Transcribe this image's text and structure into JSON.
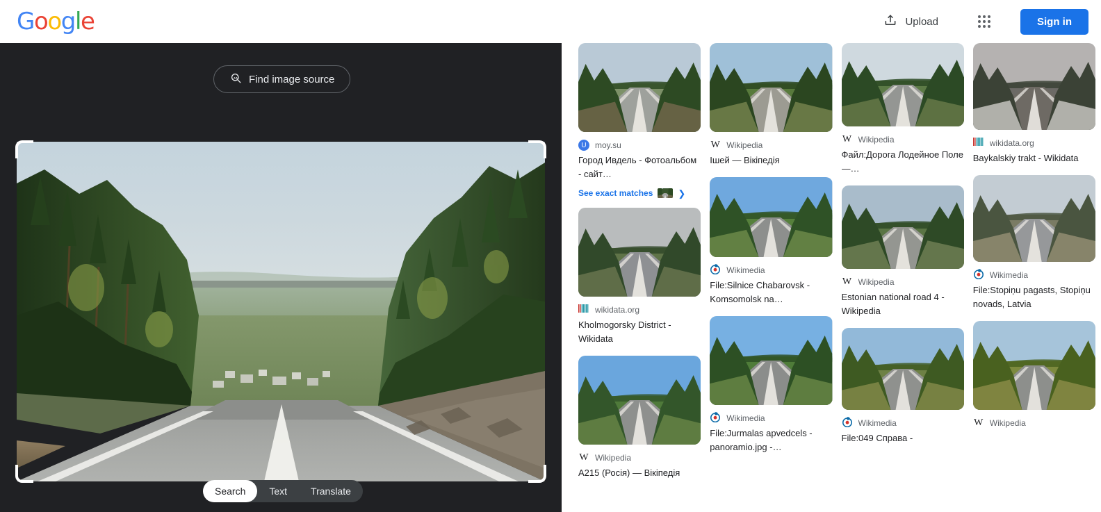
{
  "header": {
    "logo_text": "Google",
    "upload_label": "Upload",
    "upload_icon": "upload-icon",
    "apps_icon": "apps-grid-icon",
    "signin_label": "Sign in"
  },
  "left_pane": {
    "find_source_label": "Find image source",
    "find_source_icon": "image-search-icon",
    "modes": [
      {
        "label": "Search",
        "active": true
      },
      {
        "label": "Text",
        "active": false
      },
      {
        "label": "Translate",
        "active": false
      }
    ],
    "crop_handles": [
      "top-left",
      "top-right",
      "bottom-left",
      "bottom-right"
    ],
    "image_alt": "Forested highway descending toward a valley town"
  },
  "colors": {
    "accent_blue": "#1a73e8",
    "dark_panel": "#202124",
    "tab_track": "#3c4043",
    "text_primary": "#202124",
    "text_secondary": "#5f6368"
  },
  "results": [
    {
      "source": "moy.su",
      "favicon": "letter-u-favicon",
      "title": "Город Ивдель - Фотоальбом - сайт…",
      "thumb": "road-descending-valley",
      "thumb_height": 128,
      "column": 0,
      "exact_matches_label": "See exact matches"
    },
    {
      "source": "wikidata.org",
      "favicon": "wikidata-barcode-favicon",
      "title": "Kholmogorsky District - Wikidata",
      "thumb": "wet-road-grey-sky",
      "thumb_height": 128,
      "column": 1
    },
    {
      "source": "Wikipedia",
      "favicon": "wikipedia-w-favicon",
      "title": "А215 (Росія) — Вікіпедія",
      "thumb": "blue-sky-forest-road",
      "thumb_height": 128,
      "column": 2
    },
    {
      "source": "Wikipedia",
      "favicon": "wikipedia-w-favicon",
      "title": "Ішей — Вікіпедія",
      "thumb": "green-forest-roadside",
      "thumb_height": 128,
      "column": 3
    },
    {
      "source": "Wikimedia",
      "favicon": "wikimedia-globe-favicon",
      "title": "File:Silnice Chabarovsk - Komsomolsk na…",
      "thumb": "wide-highway-blue-sky",
      "thumb_height": 115,
      "column": 0
    },
    {
      "source": "Wikimedia",
      "favicon": "wikimedia-globe-favicon",
      "title": "File:Jurmalas apvedcels - panoramio.jpg -…",
      "thumb": "road-with-white-truck",
      "thumb_height": 128,
      "column": 1
    },
    {
      "source": "Wikipedia",
      "favicon": "wikipedia-w-favicon",
      "title": "Файл:Дорога Лодейное Поле —…",
      "thumb": "straight-road-horizon",
      "thumb_height": 120,
      "column": 2
    },
    {
      "source": "Wikipedia",
      "favicon": "wikipedia-w-favicon",
      "title": "Estonian national road 4 - Wikipedia",
      "thumb": "dual-carriageway-forest",
      "thumb_height": 120,
      "column": 3
    },
    {
      "source": "Wikimedia",
      "favicon": "wikimedia-globe-favicon",
      "title": "File:049 Справа -",
      "thumb": "autumn-road-field",
      "thumb_height": 118,
      "column": 1
    },
    {
      "source": "wikidata.org",
      "favicon": "wikidata-barcode-favicon",
      "title": "Baykalskiy trakt - Wikidata",
      "thumb": "winter-road-snow",
      "thumb_height": 125,
      "column": 2
    },
    {
      "source": "Wikimedia",
      "favicon": "wikimedia-globe-favicon",
      "title": "File:Stopiņu pagasts, Stopiņu novads, Latvia",
      "thumb": "early-spring-road",
      "thumb_height": 125,
      "column": 3
    },
    {
      "source": "Wikipedia",
      "favicon": "wikipedia-w-favicon",
      "title": "",
      "thumb": "autumn-birch-road",
      "thumb_height": 128,
      "column": 0
    }
  ]
}
